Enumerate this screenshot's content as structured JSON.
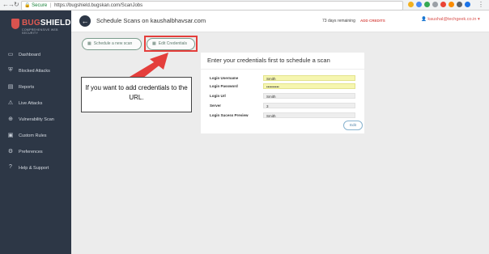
{
  "browser": {
    "secure_label": "Secure",
    "url": "https://bugshield.bugskan.com/ScanJobs"
  },
  "brand": {
    "name_prefix": "BUG",
    "name_suffix": "SHIELD",
    "tagline": "COMPREHENSIVE WEB SECURITY"
  },
  "sidebar": {
    "items": [
      {
        "label": "Dashboard",
        "icon": "monitor-icon",
        "glyph": "▭"
      },
      {
        "label": "Blocked Attacks",
        "icon": "shield-icon",
        "glyph": "⛨"
      },
      {
        "label": "Reports",
        "icon": "report-icon",
        "glyph": "▤"
      },
      {
        "label": "Live Attacks",
        "icon": "warning-icon",
        "glyph": "⚠"
      },
      {
        "label": "Vulnerability Scan",
        "icon": "crosshair-icon",
        "glyph": "⊕"
      },
      {
        "label": "Custom Rules",
        "icon": "rules-icon",
        "glyph": "▣"
      },
      {
        "label": "Preferences",
        "icon": "gear-icon",
        "glyph": "⚙"
      },
      {
        "label": "Help & Support",
        "icon": "help-icon",
        "glyph": "?"
      }
    ]
  },
  "header": {
    "title": "Schedule Scans on kaushalbhavsar.com",
    "days_remaining": "73 days remaining",
    "add_credits": "ADD CREDITS",
    "user_email": "kaushal@techgeek.co.in"
  },
  "tabs": {
    "schedule_new": "Schedule a new scan",
    "edit_credentials": "Edit Credentials"
  },
  "panel": {
    "title": "Enter your credentials first to schedule a scan",
    "fields": [
      {
        "label": "Login Username",
        "value": "Smith"
      },
      {
        "label": "Login Password",
        "value": "••••••••••"
      },
      {
        "label": "Login Url",
        "value": "Smith"
      },
      {
        "label": "Server",
        "value": "3"
      },
      {
        "label": "Login Sucess Preview",
        "value": "Smith"
      }
    ],
    "edit_label": "Edit"
  },
  "callout": {
    "text": "If you want to add credentials to the URL."
  },
  "colors": {
    "sidebar_bg": "#2d3746",
    "accent_red": "#e43e3b",
    "highlight_field": "#f6f6b0"
  }
}
